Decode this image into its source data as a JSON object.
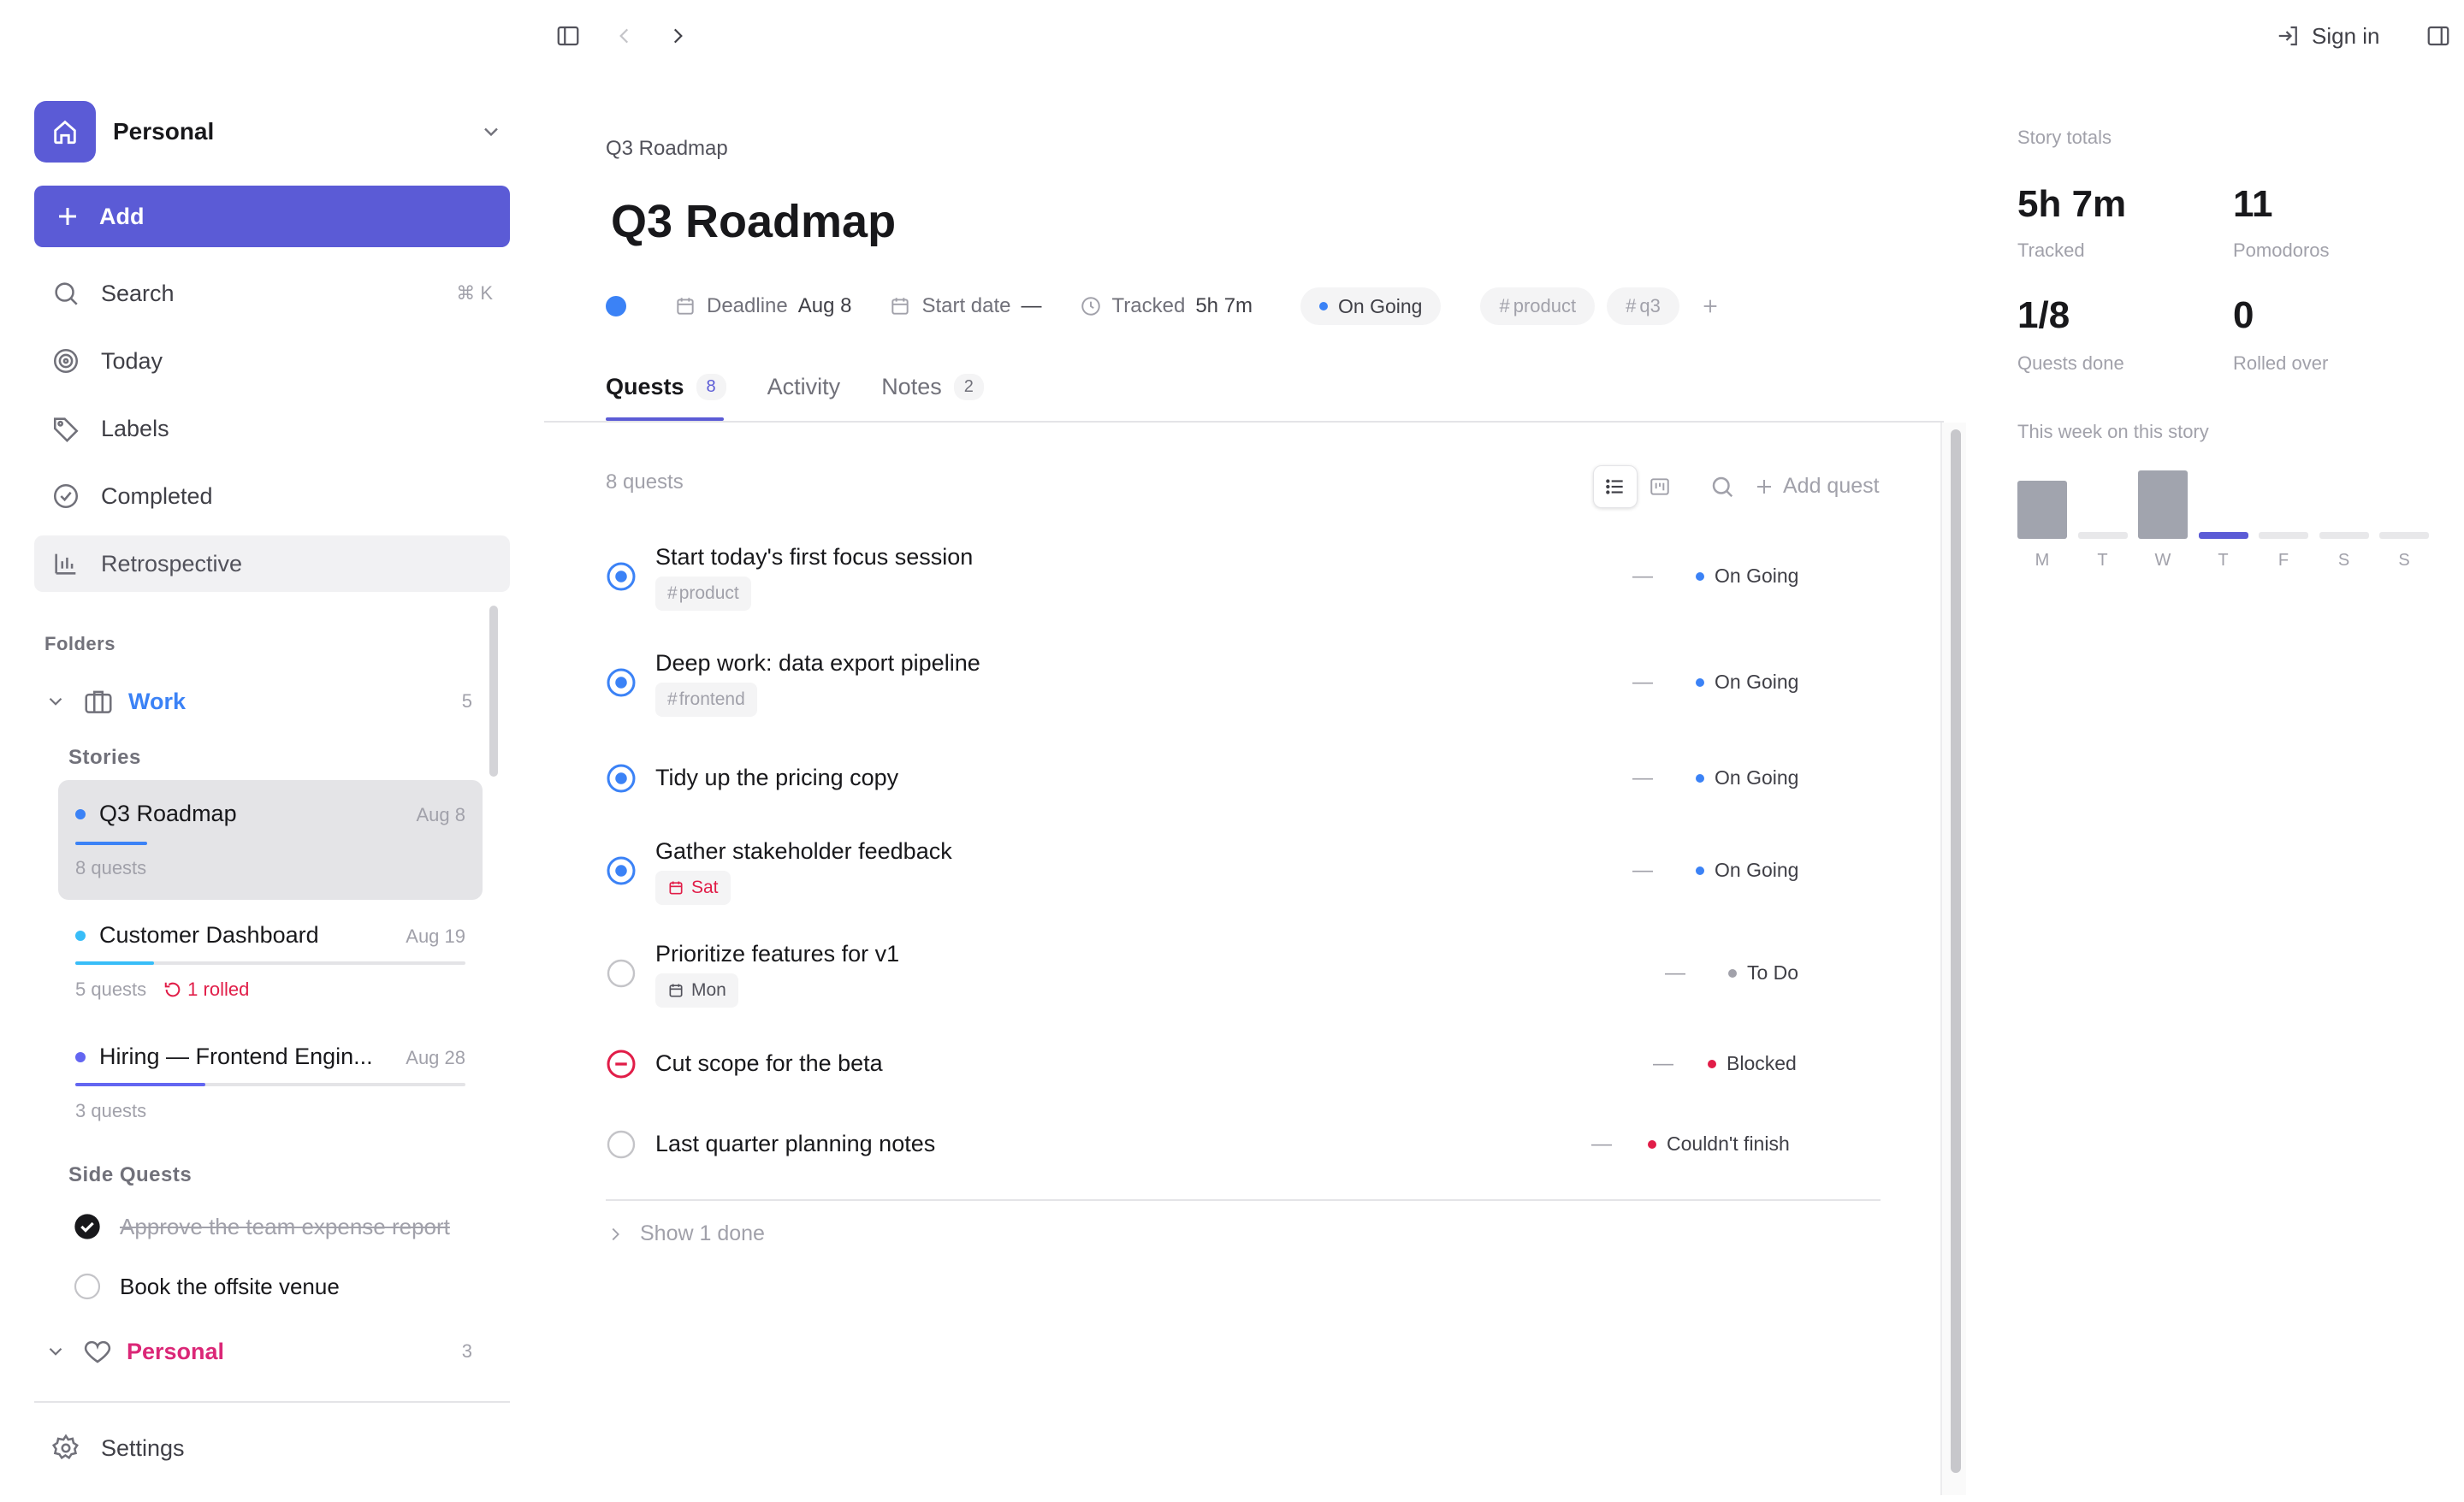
{
  "topbar": {
    "sign_in": "Sign in"
  },
  "sidebar": {
    "workspace": "Personal",
    "add_label": "Add",
    "nav": [
      {
        "label": "Search",
        "shortcut": "⌘ K"
      },
      {
        "label": "Today"
      },
      {
        "label": "Labels"
      },
      {
        "label": "Completed"
      },
      {
        "label": "Retrospective"
      }
    ],
    "folders_heading": "Folders",
    "work_folder": {
      "name": "Work",
      "count": "5",
      "color": "#3b82f6"
    },
    "stories_heading": "Stories",
    "stories": [
      {
        "title": "Q3 Roadmap",
        "date": "Aug 8",
        "meta": "8 quests",
        "color": "#3b82f6",
        "progress": 0.125
      },
      {
        "title": "Customer Dashboard",
        "date": "Aug 19",
        "meta": "5 quests",
        "rolled": "1 rolled",
        "color": "#38bdf8",
        "progress": 0.2
      },
      {
        "title": "Hiring — Frontend Engin...",
        "date": "Aug 28",
        "meta": "3 quests",
        "color": "#6366f1",
        "progress": 0.333
      }
    ],
    "side_quests_heading": "Side Quests",
    "side_quests": [
      {
        "label": "Approve the team expense report",
        "done": true
      },
      {
        "label": "Book the offsite venue",
        "done": false
      }
    ],
    "personal_folder": {
      "name": "Personal",
      "count": "3",
      "color": "#db2777"
    },
    "settings": "Settings"
  },
  "main": {
    "breadcrumb": "Q3 Roadmap",
    "title": "Q3 Roadmap",
    "props": {
      "deadline_label": "Deadline",
      "deadline_value": "Aug 8",
      "start_label": "Start date",
      "start_value": "—",
      "tracked_label": "Tracked",
      "tracked_value": "5h 7m",
      "status": "On Going",
      "tags": [
        "product",
        "q3"
      ]
    },
    "tabs": [
      {
        "label": "Quests",
        "count": "8"
      },
      {
        "label": "Activity"
      },
      {
        "label": "Notes",
        "count": "2"
      }
    ],
    "quest_count": "8 quests",
    "add_quest": "Add quest",
    "quests": [
      {
        "title": "Start today's first focus session",
        "tag": "product",
        "dash": "—",
        "status": "On Going"
      },
      {
        "title": "Deep work: data export pipeline",
        "tag": "frontend",
        "dash": "—",
        "status": "On Going"
      },
      {
        "title": "Tidy up the pricing copy",
        "dash": "—",
        "status": "On Going"
      },
      {
        "title": "Gather stakeholder feedback",
        "due": "Sat",
        "dash": "—",
        "status": "On Going"
      },
      {
        "title": "Prioritize features for v1",
        "due": "Mon",
        "dash": "—",
        "status": "To Do"
      },
      {
        "title": "Cut scope for the beta",
        "dash": "—",
        "status": "Blocked"
      },
      {
        "title": "Last quarter planning notes",
        "dash": "—",
        "status": "Couldn't finish"
      }
    ],
    "show_done": "Show 1 done"
  },
  "right_panel": {
    "heading": "Story totals",
    "stats": [
      {
        "value": "5h 7m",
        "label": "Tracked"
      },
      {
        "value": "11",
        "label": "Pomodoros"
      },
      {
        "value": "1/8",
        "label": "Quests done"
      },
      {
        "value": "0",
        "label": "Rolled over"
      }
    ],
    "week_heading": "This week on this story",
    "week": {
      "days": [
        "M",
        "T",
        "W",
        "T",
        "F",
        "S",
        "S"
      ],
      "levels": [
        0.85,
        0.0,
        1.0,
        0.0,
        0.0,
        0.0,
        0.0
      ],
      "today_index": 3
    }
  },
  "colors": {
    "accent": "#5b5bd6",
    "ongoing": "#3b82f6",
    "todo": "#a1a1aa",
    "blocked": "#e11d48"
  }
}
